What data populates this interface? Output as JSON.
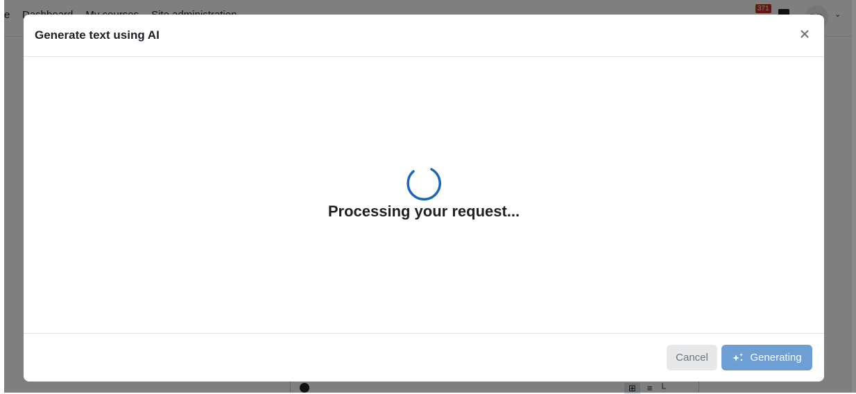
{
  "background": {
    "nav": {
      "brand": "e",
      "links": [
        "Dashboard",
        "My courses",
        "Site administration"
      ],
      "notification_count": "371",
      "avatar_initials": "BD"
    }
  },
  "modal": {
    "title": "Generate text using AI",
    "close_icon": "close-icon",
    "status_text": "Processing your request...",
    "spinner_icon": "loading-spinner-icon",
    "buttons": {
      "cancel_label": "Cancel",
      "generate_label": "Generating",
      "generate_icon": "sparkle-icon"
    }
  },
  "colors": {
    "accent": "#0f6cbf",
    "generate_button": "#6d9fd5",
    "cancel_button": "#e6e8ea",
    "notification_badge": "#ca3120"
  }
}
